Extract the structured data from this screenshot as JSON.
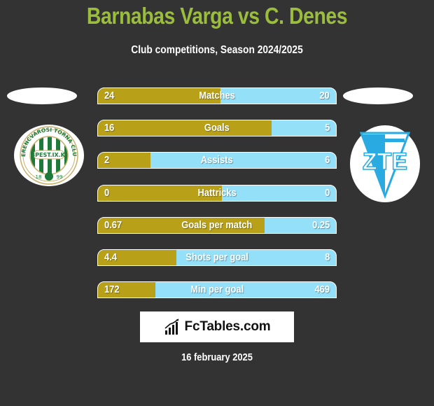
{
  "header": {
    "title": "Barnabas Varga vs C. Denes",
    "subtitle": "Club competitions, Season 2024/2025"
  },
  "colors": {
    "background": "#333333",
    "title": "#9bbd3c",
    "left_bar": "#b8a119",
    "right_bar": "#93e0f8",
    "white": "#ffffff"
  },
  "teams": {
    "left": {
      "logo_icon": "ferencvarosi-torna-club-crest",
      "crest_text_top": "FERENCVAROSI TORNA CLUB",
      "crest_text_mid": "BPEST.IX.K.",
      "crest_year_left": "18",
      "crest_year_right": "99"
    },
    "right": {
      "logo_icon": "zte-crest",
      "crest_text": "ZTE"
    }
  },
  "stats": [
    {
      "label": "Matches",
      "left": "24",
      "right": "20",
      "left_share": 51.5
    },
    {
      "label": "Goals",
      "left": "16",
      "right": "5",
      "left_share": 73
    },
    {
      "label": "Assists",
      "left": "2",
      "right": "6",
      "left_share": 22
    },
    {
      "label": "Hattricks",
      "left": "0",
      "right": "0",
      "left_share": 52
    },
    {
      "label": "Goals per match",
      "left": "0.67",
      "right": "0.25",
      "left_share": 70
    },
    {
      "label": "Shots per goal",
      "left": "4.4",
      "right": "8",
      "left_share": 33
    },
    {
      "label": "Min per goal",
      "left": "172",
      "right": "469",
      "left_share": 24
    }
  ],
  "brand": {
    "name": "FcTables.com",
    "icon": "bar-chart-growth-icon"
  },
  "footer": {
    "date": "16 february 2025"
  }
}
